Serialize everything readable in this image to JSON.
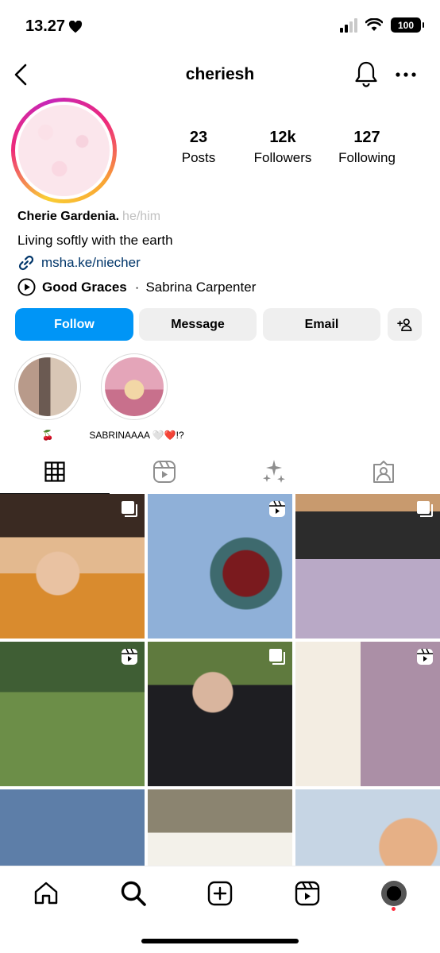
{
  "status_bar": {
    "time": "13.27",
    "battery": "100"
  },
  "header": {
    "username": "cheriesh"
  },
  "profile": {
    "stats": [
      {
        "value": "23",
        "label": "Posts"
      },
      {
        "value": "12k",
        "label": "Followers"
      },
      {
        "value": "127",
        "label": "Following"
      }
    ],
    "name": "Cherie Gardenia.",
    "pronouns": "he/him",
    "bio": "Living softly with the earth",
    "link": "msha.ke/niecher",
    "music": {
      "song": "Good Graces",
      "separator": "·",
      "artist": "Sabrina Carpenter"
    }
  },
  "actions": {
    "follow": "Follow",
    "message": "Message",
    "email": "Email"
  },
  "highlights": [
    {
      "label": "🍒"
    },
    {
      "label": "SABRINAAAA 🤍❤️!?"
    }
  ],
  "tabs": [
    "grid-icon",
    "reels-icon",
    "sparkles-icon",
    "tagged-icon"
  ],
  "colors": {
    "follow": "#0095f6",
    "link": "#003569",
    "notification": "#ff3040"
  }
}
